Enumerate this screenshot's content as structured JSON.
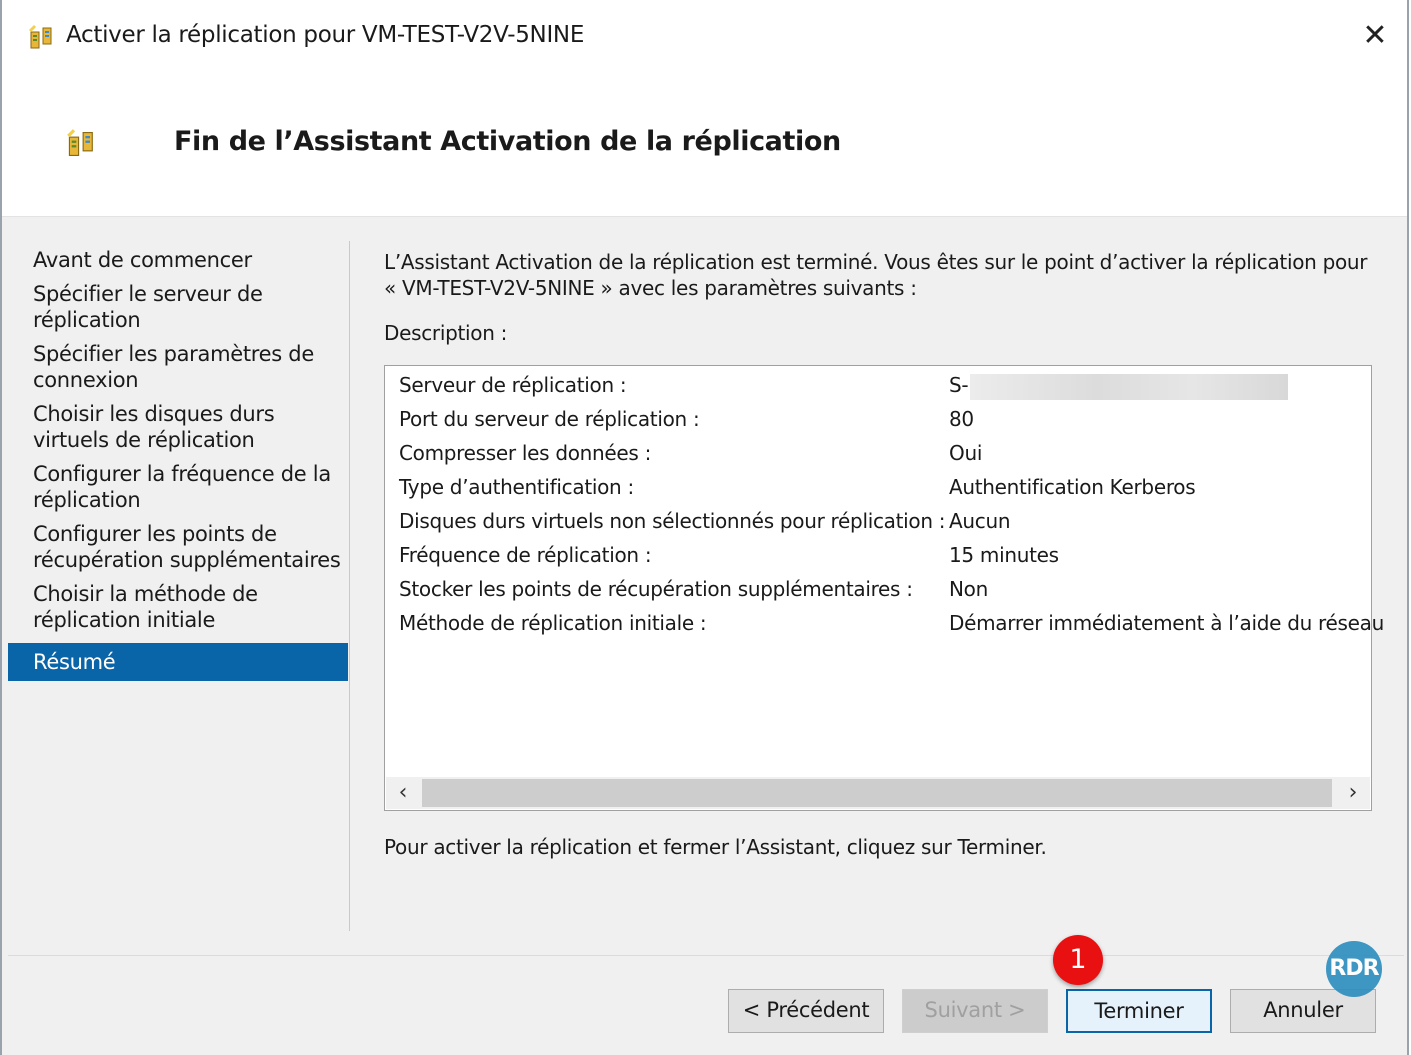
{
  "window": {
    "title": "Activer la réplication pour VM-TEST-V2V-5NINE",
    "close_label": "✕",
    "icon": "replication-wizard-icon"
  },
  "header": {
    "title": "Fin de l’Assistant Activation de la réplication",
    "icon": "replication-wizard-icon"
  },
  "nav": {
    "items": [
      {
        "label": "Avant de commencer"
      },
      {
        "label": "Spécifier le serveur de réplication"
      },
      {
        "label": "Spécifier les paramètres de connexion"
      },
      {
        "label": "Choisir les disques durs virtuels de réplication"
      },
      {
        "label": "Configurer la fréquence de la réplication"
      },
      {
        "label": "Configurer les points de récupération supplémentaires"
      },
      {
        "label": "Choisir la méthode de réplication initiale"
      },
      {
        "label": "Résumé"
      }
    ],
    "active_index": 7
  },
  "content": {
    "intro_line1": "L’Assistant Activation de la réplication est terminé. Vous êtes sur le point d’activer la réplication pour",
    "intro_line2": "« VM-TEST-V2V-5NINE » avec les paramètres suivants :",
    "description_label": "Description :",
    "rows": [
      {
        "label": "Serveur de réplication :",
        "value": "S-"
      },
      {
        "label": "Port du serveur de réplication :",
        "value": "80"
      },
      {
        "label": "Compresser les données :",
        "value": "Oui"
      },
      {
        "label": "Type d’authentification :",
        "value": "Authentification Kerberos"
      },
      {
        "label": "Disques durs virtuels non sélectionnés pour réplication :",
        "value": "Aucun"
      },
      {
        "label": "Fréquence de réplication :",
        "value": "15 minutes"
      },
      {
        "label": "Stocker les points de récupération supplémentaires :",
        "value": "Non"
      },
      {
        "label": "Méthode de réplication initiale :",
        "value": "Démarrer immédiatement à l’aide du réseau"
      }
    ],
    "scroll_left": "‹",
    "scroll_right": "›",
    "finish_hint": "Pour activer la réplication et fermer l’Assistant, cliquez sur Terminer."
  },
  "buttons": {
    "previous": "< Précédent",
    "next": "Suivant >",
    "finish": "Terminer",
    "cancel": "Annuler"
  },
  "annotation": {
    "badge": "1",
    "watermark": "RDR"
  },
  "colors": {
    "accent": "#0a64a8",
    "badge": "#e81010"
  }
}
